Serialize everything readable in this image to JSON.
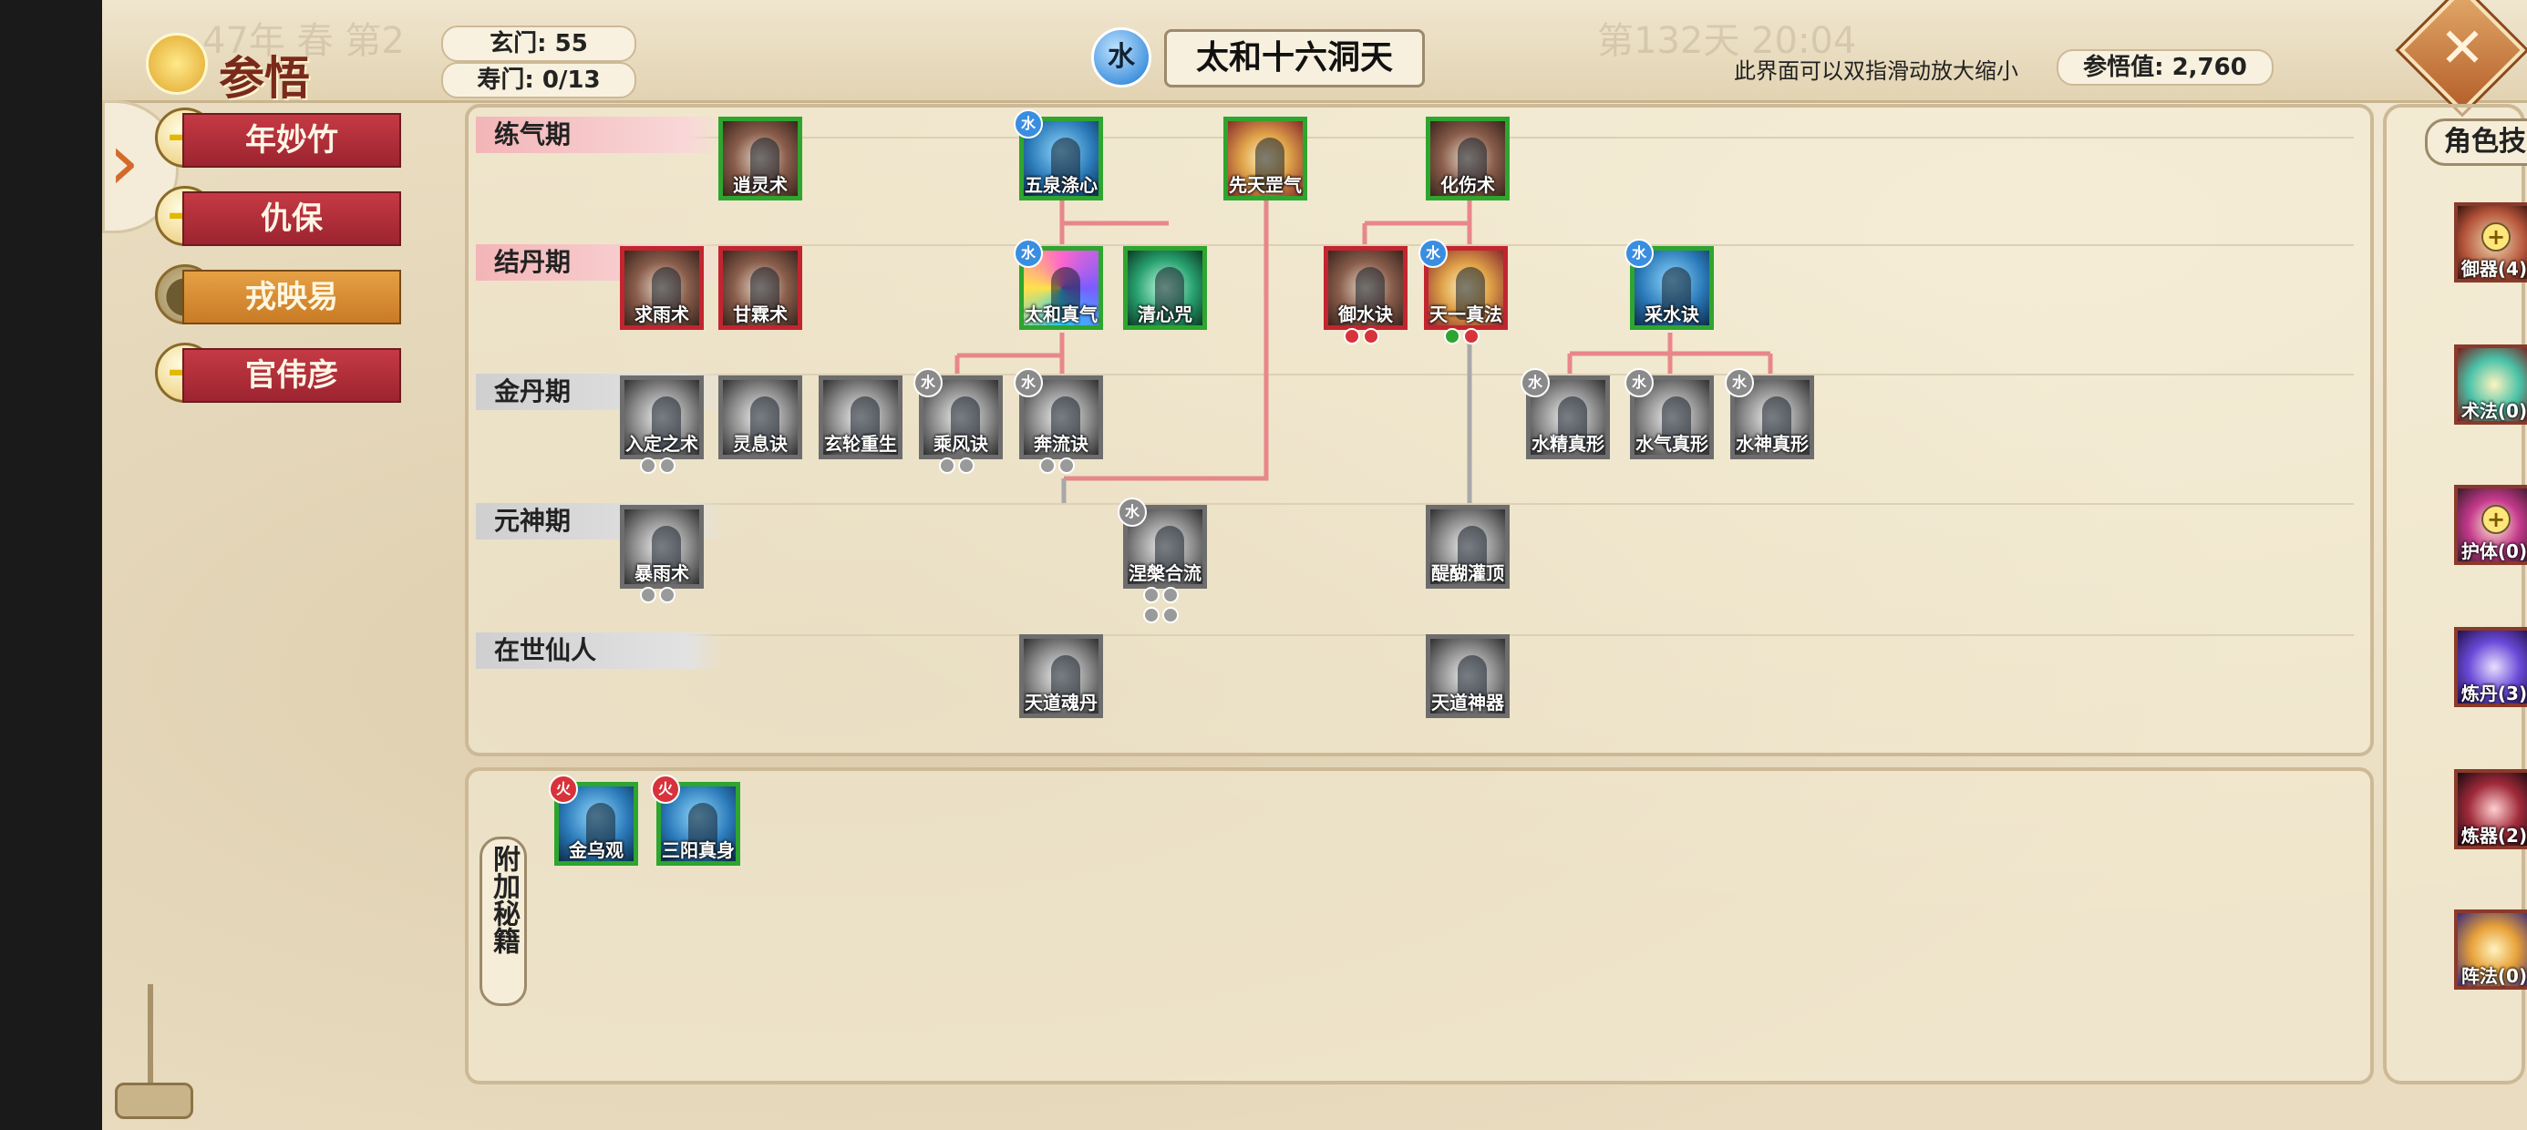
{
  "header": {
    "logo_text": "参悟",
    "xuanmen": "玄门: 55",
    "shoumen": "寿门: 0/13",
    "element_badge": "水",
    "title": "太和十六洞天",
    "hint": "此界面可以双指滑动放大缩小",
    "comprehension": "参悟值: 2,760",
    "close": "✕",
    "ghost_left": "47年 春 第2",
    "ghost_right": "第132天 20:04"
  },
  "characters": [
    {
      "name": "年妙竹",
      "active": false
    },
    {
      "name": "仇保",
      "active": false
    },
    {
      "name": "戎映易",
      "active": true
    },
    {
      "name": "官伟彦",
      "active": false
    }
  ],
  "realms": [
    "练气期",
    "结丹期",
    "金丹期",
    "元神期",
    "在世仙人"
  ],
  "tree_nodes": [
    {
      "id": "n1",
      "label": "逍灵术",
      "state": "green",
      "art": "brown",
      "badge": ""
    },
    {
      "id": "n2",
      "label": "五泉涤心",
      "state": "green",
      "art": "blue",
      "badge": "水"
    },
    {
      "id": "n3",
      "label": "先天罡气",
      "state": "green",
      "art": "gold",
      "badge": ""
    },
    {
      "id": "n4",
      "label": "化伤术",
      "state": "green",
      "art": "brown",
      "badge": ""
    },
    {
      "id": "n5",
      "label": "求雨术",
      "state": "red",
      "art": "brown",
      "badge": ""
    },
    {
      "id": "n6",
      "label": "甘霖术",
      "state": "red",
      "art": "brown",
      "badge": ""
    },
    {
      "id": "n7",
      "label": "太和真气",
      "state": "green",
      "art": "purple",
      "badge": "水"
    },
    {
      "id": "n8",
      "label": "清心咒",
      "state": "green",
      "art": "teal",
      "badge": ""
    },
    {
      "id": "n9",
      "label": "御水诀",
      "state": "red",
      "art": "brown",
      "badge": ""
    },
    {
      "id": "n10",
      "label": "天一真法",
      "state": "red",
      "art": "gold",
      "badge": "水"
    },
    {
      "id": "n11",
      "label": "采水诀",
      "state": "green",
      "art": "blue",
      "badge": "水"
    },
    {
      "id": "n12",
      "label": "入定之术",
      "state": "gray",
      "art": "gray",
      "badge": ""
    },
    {
      "id": "n13",
      "label": "灵息诀",
      "state": "gray",
      "art": "gray",
      "badge": ""
    },
    {
      "id": "n14",
      "label": "玄轮重生",
      "state": "gray",
      "art": "gray",
      "badge": ""
    },
    {
      "id": "n15",
      "label": "乘风诀",
      "state": "gray",
      "art": "gray",
      "badge": "水"
    },
    {
      "id": "n16",
      "label": "奔流诀",
      "state": "gray",
      "art": "gray",
      "badge": "水"
    },
    {
      "id": "n17",
      "label": "水精真形",
      "state": "gray",
      "art": "gray",
      "badge": "水"
    },
    {
      "id": "n18",
      "label": "水气真形",
      "state": "gray",
      "art": "gray",
      "badge": "水"
    },
    {
      "id": "n19",
      "label": "水神真形",
      "state": "gray",
      "art": "gray",
      "badge": "水"
    },
    {
      "id": "n20",
      "label": "暴雨术",
      "state": "gray",
      "art": "gray",
      "badge": ""
    },
    {
      "id": "n21",
      "label": "涅槃合流",
      "state": "gray",
      "art": "gray",
      "badge": "水"
    },
    {
      "id": "n22",
      "label": "醍醐灌顶",
      "state": "gray",
      "art": "gray",
      "badge": ""
    },
    {
      "id": "n23",
      "label": "天道魂丹",
      "state": "gray",
      "art": "gray",
      "badge": ""
    },
    {
      "id": "n24",
      "label": "天道神器",
      "state": "gray",
      "art": "gray",
      "badge": ""
    }
  ],
  "extra_section": {
    "label": "附加秘籍",
    "nodes": [
      {
        "id": "e1",
        "label": "金乌观",
        "badge": "火"
      },
      {
        "id": "e2",
        "label": "三阳真身",
        "badge": "火"
      }
    ]
  },
  "side_skills": {
    "title": "角色技能",
    "items": [
      "御器(4)",
      "术法(0)",
      "护体(0)",
      "炼丹(3)",
      "炼器(2)",
      "阵法(0)"
    ]
  },
  "colors": {
    "active_link": "#e8878a",
    "inactive_link": "#a8a8a8",
    "learned_border": "#2ea52e",
    "locked_border": "#c2252f",
    "water": "#3a8ee0",
    "fire": "#d8323a"
  }
}
